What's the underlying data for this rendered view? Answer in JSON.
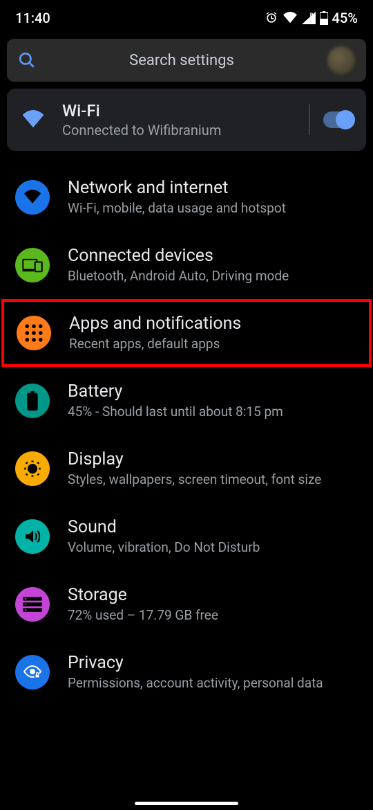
{
  "status": {
    "time": "11:40",
    "battery_text": "45%"
  },
  "search": {
    "placeholder": "Search settings"
  },
  "wifi_card": {
    "title": "Wi-Fi",
    "subtitle": "Connected to Wifibranium"
  },
  "items": [
    {
      "title": "Network and internet",
      "subtitle": "Wi-Fi, mobile, data usage and hotspot",
      "icon": "wifi",
      "bg": "#1a73e8",
      "fg": "#000000"
    },
    {
      "title": "Connected devices",
      "subtitle": "Bluetooth, Android Auto, Driving mode",
      "icon": "devices",
      "bg": "#5bb91d",
      "fg": "#000000"
    },
    {
      "title": "Apps and notifications",
      "subtitle": "Recent apps, default apps",
      "icon": "apps",
      "bg": "#ff7b17",
      "fg": "#000000",
      "highlight": true
    },
    {
      "title": "Battery",
      "subtitle": "45% - Should last until about 8:15 pm",
      "icon": "battery",
      "bg": "#009688",
      "fg": "#000000"
    },
    {
      "title": "Display",
      "subtitle": "Styles, wallpapers, screen timeout, font size",
      "icon": "display",
      "bg": "#f9ab00",
      "fg": "#000000"
    },
    {
      "title": "Sound",
      "subtitle": "Volume, vibration, Do Not Disturb",
      "icon": "sound",
      "bg": "#00b3a6",
      "fg": "#000000"
    },
    {
      "title": "Storage",
      "subtitle": "72% used – 17.79 GB free",
      "icon": "storage",
      "bg": "#c344d6",
      "fg": "#000000"
    },
    {
      "title": "Privacy",
      "subtitle": "Permissions, account activity, personal data",
      "icon": "privacy",
      "bg": "#1a73e8",
      "fg": "#ffffff"
    }
  ]
}
